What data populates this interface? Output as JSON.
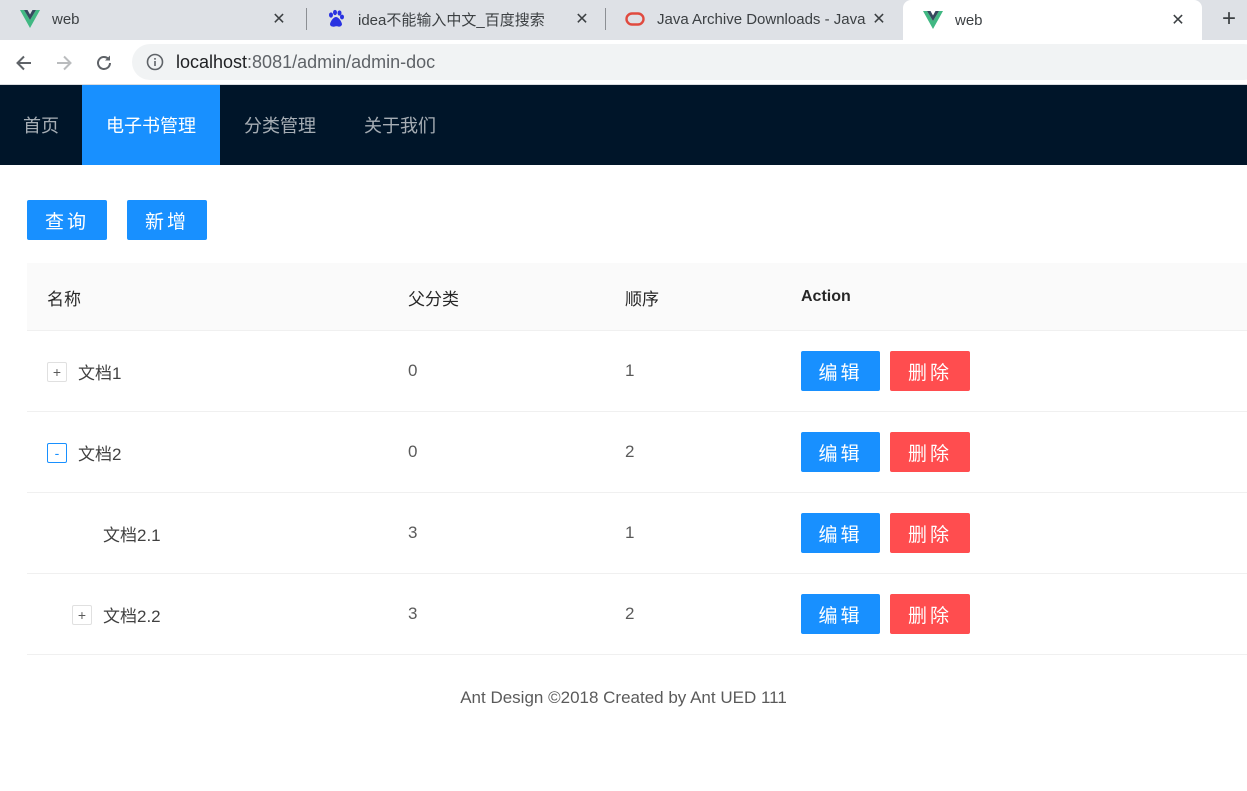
{
  "browser": {
    "tabs": [
      {
        "title": "web",
        "favicon": "vue-logo-icon"
      },
      {
        "title": "idea不能输入中文_百度搜索",
        "favicon": "baidu-paw-icon"
      },
      {
        "title": "Java Archive Downloads - Java",
        "favicon": "oracle-logo-icon"
      },
      {
        "title": "web",
        "favicon": "vue-logo-icon",
        "active": true
      }
    ],
    "address": {
      "host": "localhost",
      "rest": ":8081/admin/admin-doc"
    }
  },
  "header": {
    "menu": [
      "首页",
      "电子书管理",
      "分类管理",
      "关于我们"
    ],
    "selected_index": 1,
    "bg_color": "#001529",
    "selected_color": "#1890ff"
  },
  "toolbar": {
    "query_label": "查询",
    "add_label": "新增"
  },
  "table": {
    "columns": [
      "名称",
      "父分类",
      "顺序",
      "Action"
    ],
    "rows": [
      {
        "name": "文档1",
        "parent": "0",
        "sort": "1",
        "expander": "+"
      },
      {
        "name": "文档2",
        "parent": "0",
        "sort": "2",
        "expander": "-"
      },
      {
        "name": "文档2.1",
        "parent": "3",
        "sort": "1",
        "expander": ""
      },
      {
        "name": "文档2.2",
        "parent": "3",
        "sort": "2",
        "expander": "+"
      }
    ],
    "edit_label": "编辑",
    "delete_label": "删除"
  },
  "footer": {
    "text": "Ant Design ©2018 Created by Ant UED 111"
  },
  "colors": {
    "primary": "#1890ff",
    "danger": "#ff4d4f"
  }
}
